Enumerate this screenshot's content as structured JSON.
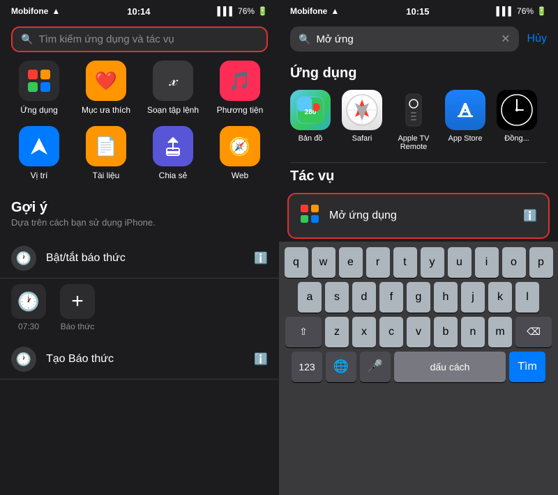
{
  "left": {
    "status": {
      "carrier": "Mobifone",
      "time": "10:14",
      "battery": "76%"
    },
    "search": {
      "placeholder": "Tìm kiếm ứng dụng và tác vụ"
    },
    "shortcuts": [
      {
        "label": "Ứng dụng",
        "emoji": "🟥🟧🟨🟩"
      },
      {
        "label": "Mục ưa thích",
        "emoji": "❤️"
      },
      {
        "label": "Soạn tập lệnh",
        "emoji": "𝑥"
      },
      {
        "label": "Phương tiện",
        "emoji": "🎵"
      },
      {
        "label": "Vị trí",
        "emoji": "📍"
      },
      {
        "label": "Tài liệu",
        "emoji": "📄"
      },
      {
        "label": "Chia sẻ",
        "emoji": "↑"
      },
      {
        "label": "Web",
        "emoji": "🧭"
      }
    ],
    "suggestions": {
      "title": "Gợi ý",
      "subtitle": "Dựa trên cách bạn sử dụng iPhone."
    },
    "list_items": [
      {
        "label": "Bật/tắt báo thức",
        "icon": "🕐"
      },
      {
        "label": "Tạo Báo thức",
        "icon": "🕐"
      }
    ],
    "alarm_clocks": [
      {
        "label": "07:30",
        "icon": "🕐"
      },
      {
        "label": "Báo thức",
        "icon": "➕"
      }
    ]
  },
  "right": {
    "status": {
      "carrier": "Mobifone",
      "time": "10:15",
      "battery": "76%"
    },
    "search": {
      "value": "Mở ứng",
      "cancel": "Hủy"
    },
    "apps_section": "Ứng dụng",
    "apps": [
      {
        "label": "Bản đồ",
        "type": "map"
      },
      {
        "label": "Safari",
        "type": "safari"
      },
      {
        "label": "Apple TV Remote",
        "type": "appletv"
      },
      {
        "label": "App Store",
        "type": "appstore"
      },
      {
        "label": "Đồng...",
        "type": "clock"
      }
    ],
    "tasks_section": "Tác vụ",
    "task": {
      "label": "Mở ứng dụng"
    },
    "keyboard": {
      "rows": [
        [
          "q",
          "w",
          "e",
          "r",
          "t",
          "y",
          "u",
          "i",
          "o",
          "p"
        ],
        [
          "a",
          "s",
          "d",
          "f",
          "g",
          "h",
          "j",
          "k",
          "l"
        ],
        [
          "⇧",
          "z",
          "x",
          "c",
          "v",
          "b",
          "n",
          "m",
          "⌫"
        ],
        [
          "123",
          "🌐",
          "🎤",
          "dấu cách",
          "Tìm"
        ]
      ]
    }
  }
}
